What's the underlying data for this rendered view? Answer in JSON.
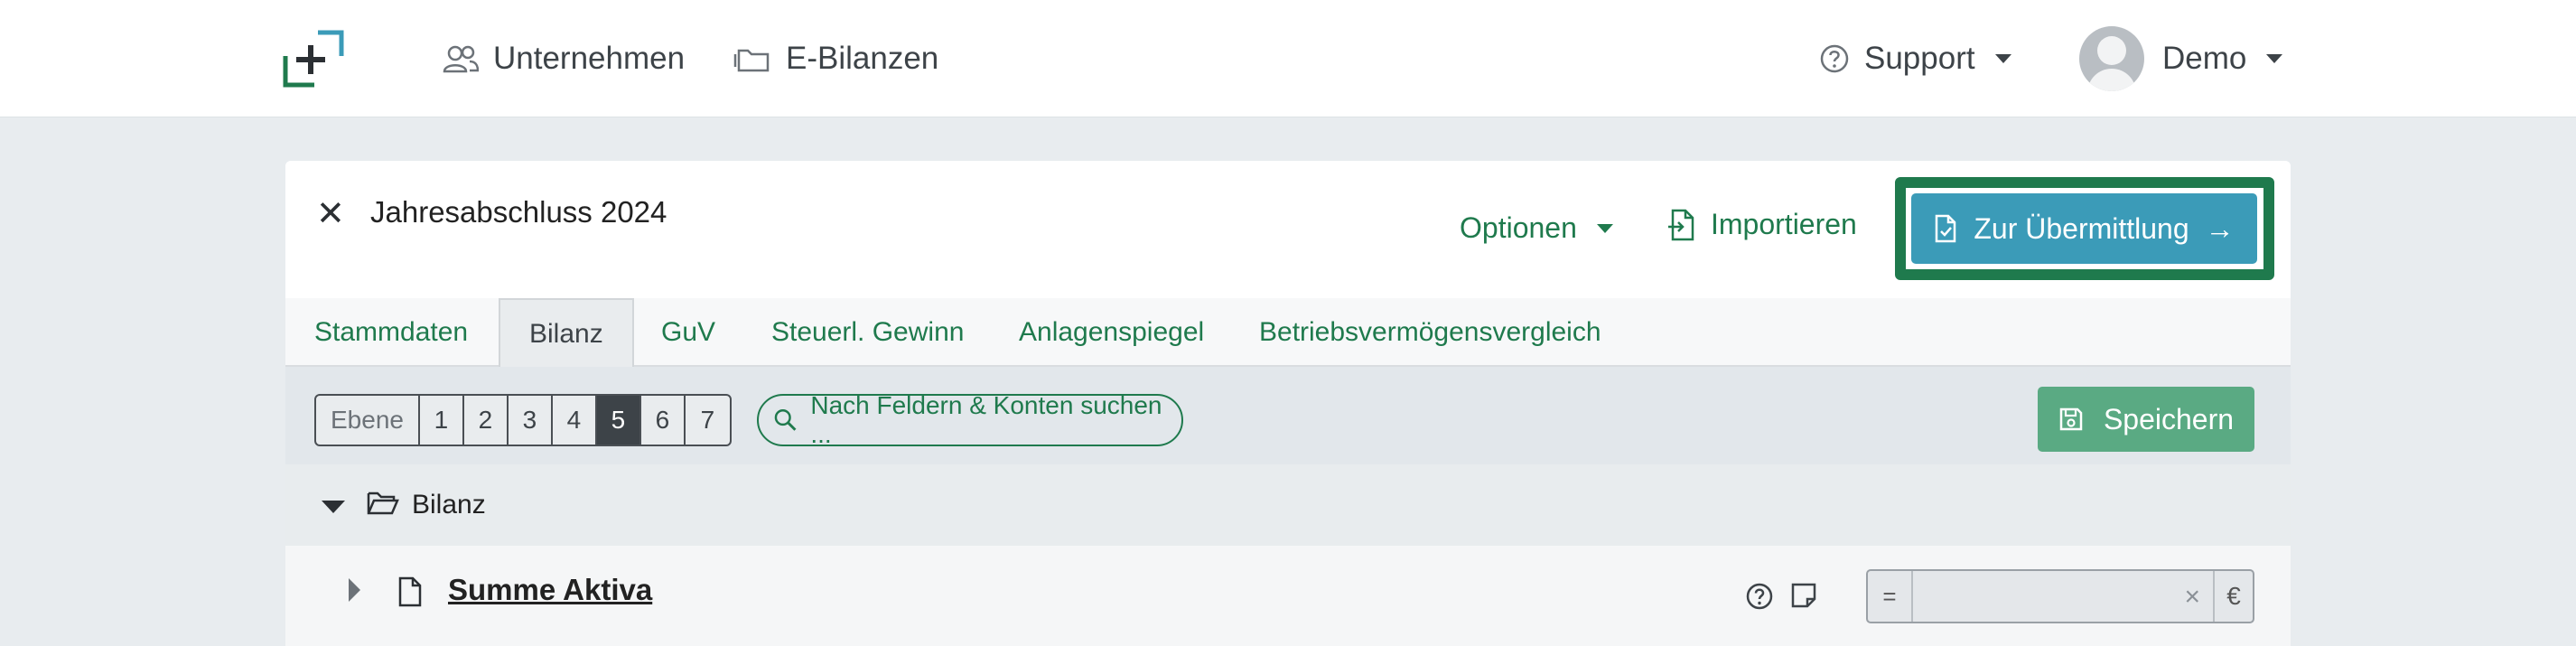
{
  "navbar": {
    "nav_items": [
      {
        "label": "Unternehmen",
        "icon": "users-icon"
      },
      {
        "label": "E-Bilanzen",
        "icon": "folder-icon"
      }
    ],
    "support_label": "Support",
    "user_name": "Demo"
  },
  "document": {
    "title": "Jahresabschluss 2024",
    "optionen_label": "Optionen",
    "import_label": "Importieren",
    "submit_label": "Zur Übermittlung",
    "submit_arrow": "→"
  },
  "tabs": [
    {
      "label": "Stammdaten",
      "active": false
    },
    {
      "label": "Bilanz",
      "active": true
    },
    {
      "label": "GuV",
      "active": false
    },
    {
      "label": "Steuerl. Gewinn",
      "active": false
    },
    {
      "label": "Anlagenspiegel",
      "active": false
    },
    {
      "label": "Betriebsvermögensvergleich",
      "active": false
    }
  ],
  "toolbar": {
    "level_label": "Ebene",
    "levels": [
      "1",
      "2",
      "3",
      "4",
      "5",
      "6",
      "7"
    ],
    "active_level": "5",
    "search_label": "Nach Feldern & Konten suchen ...",
    "save_label": "Speichern"
  },
  "tree": {
    "root_label": "Bilanz",
    "row": {
      "label": "Summe Aktiva",
      "operator": "=",
      "value": "",
      "clear": "×",
      "currency": "€"
    }
  },
  "colors": {
    "brand_green": "#1f7a4d",
    "submit_blue": "#3b9bb8",
    "save_green": "#5aaa83"
  }
}
